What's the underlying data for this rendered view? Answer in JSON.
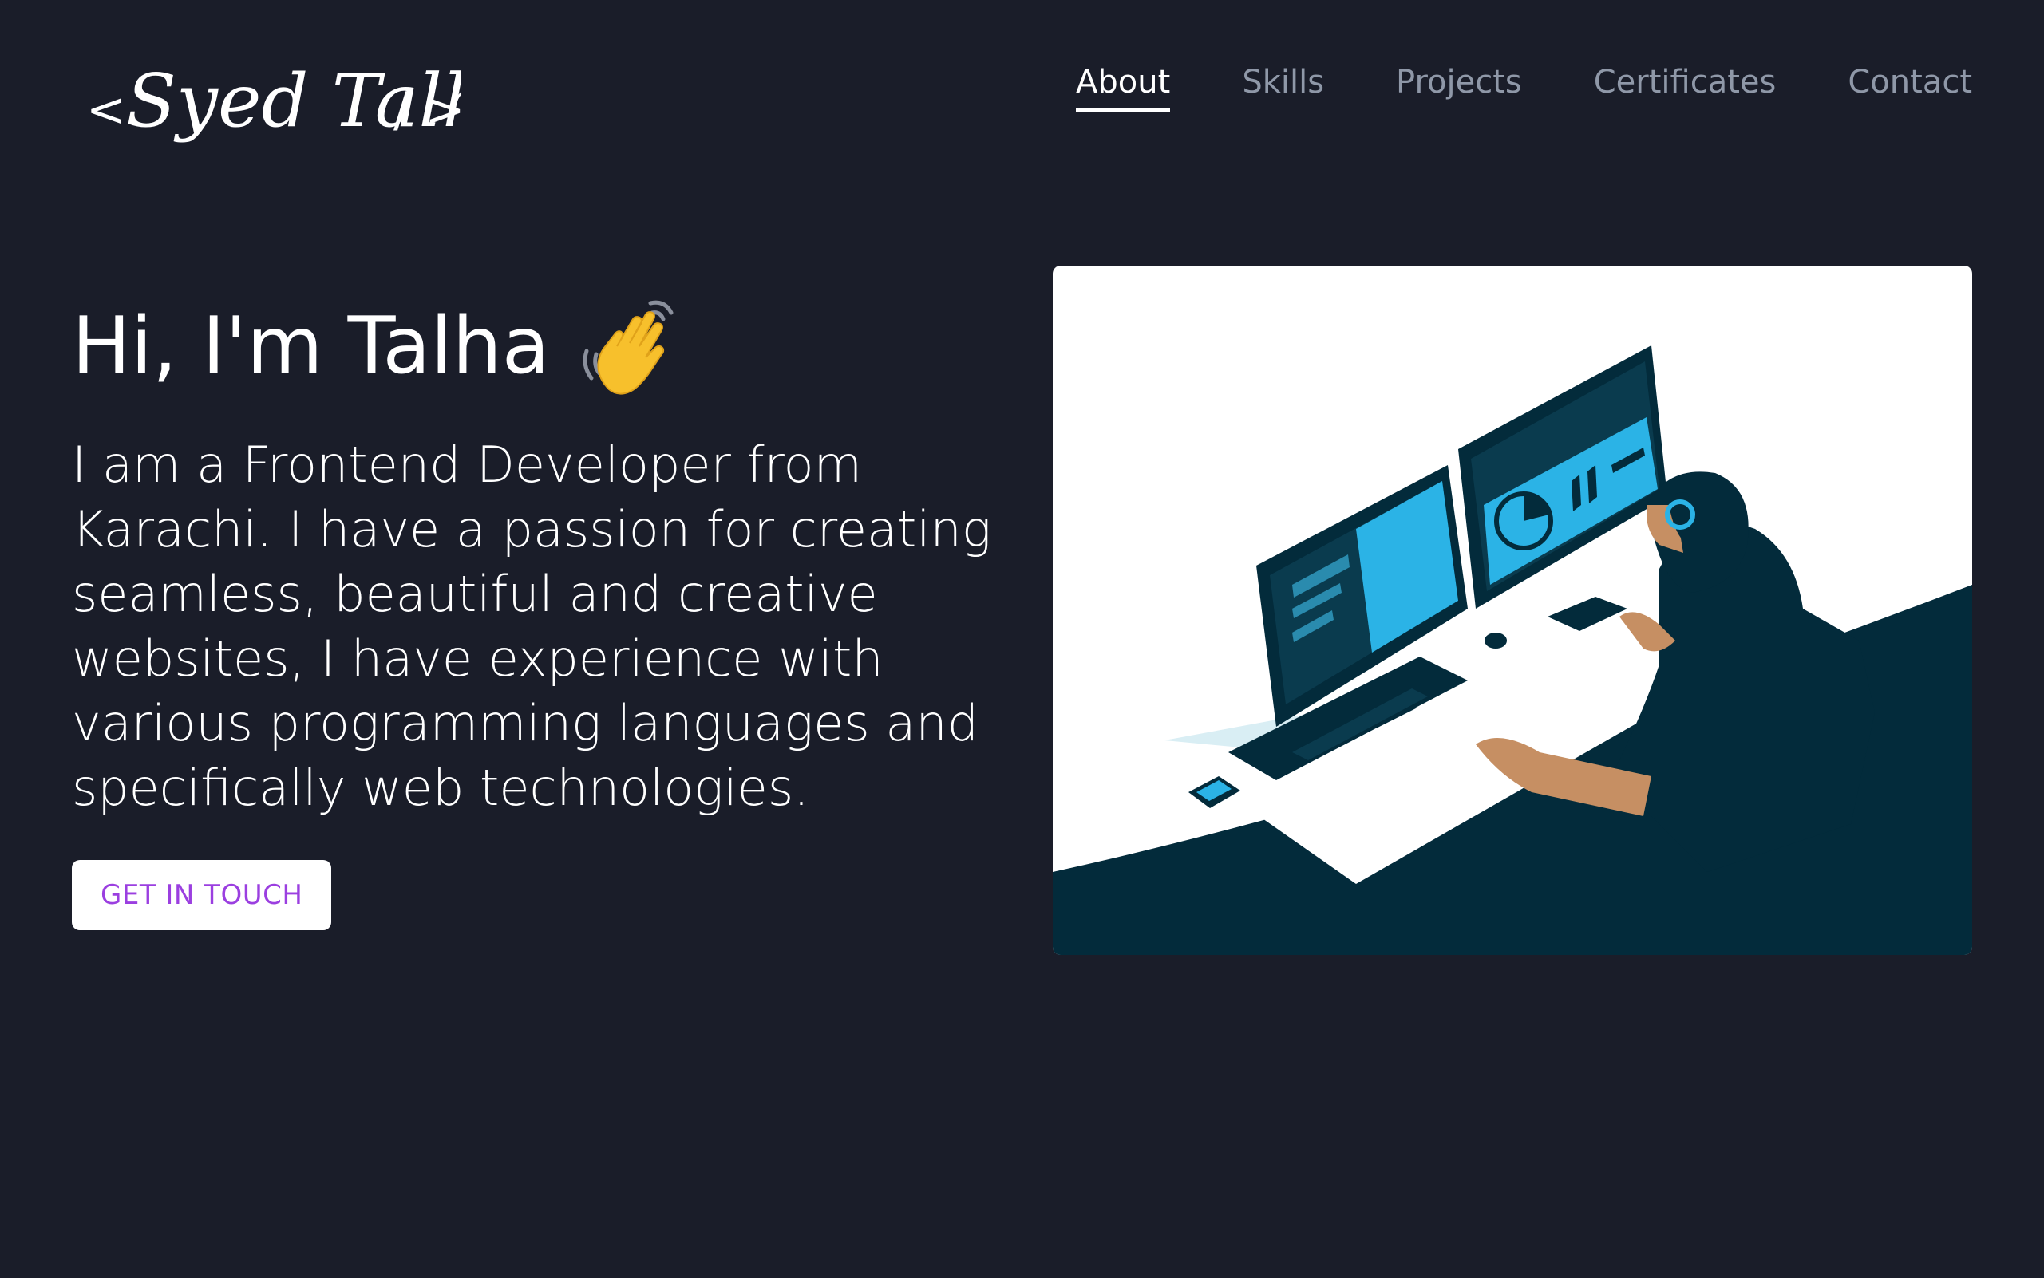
{
  "header": {
    "logo": {
      "bracket_open": "<",
      "name": "Syed Talha",
      "bracket_close": "/ >"
    },
    "nav": [
      {
        "label": "About",
        "active": true
      },
      {
        "label": "Skills",
        "active": false
      },
      {
        "label": "Projects",
        "active": false
      },
      {
        "label": "Certificates",
        "active": false
      },
      {
        "label": "Contact",
        "active": false
      }
    ]
  },
  "hero": {
    "title": "Hi, I'm Talha",
    "title_icon": "waving-hand-icon",
    "description": "I am a Frontend Developer from Karachi. I have a passion for creating seamless, beautiful and creative websites, I have experience with various programming languages and specifically web technologies.",
    "cta_label": "GET IN TOUCH",
    "illustration": "developer-at-desk-illustration"
  },
  "colors": {
    "background": "#1a1d29",
    "text": "#ffffff",
    "nav_inactive": "#8f98a8",
    "cta_text": "#9b3fe0",
    "illustration_dark": "#032b3b",
    "illustration_accent": "#2bb3e6"
  }
}
